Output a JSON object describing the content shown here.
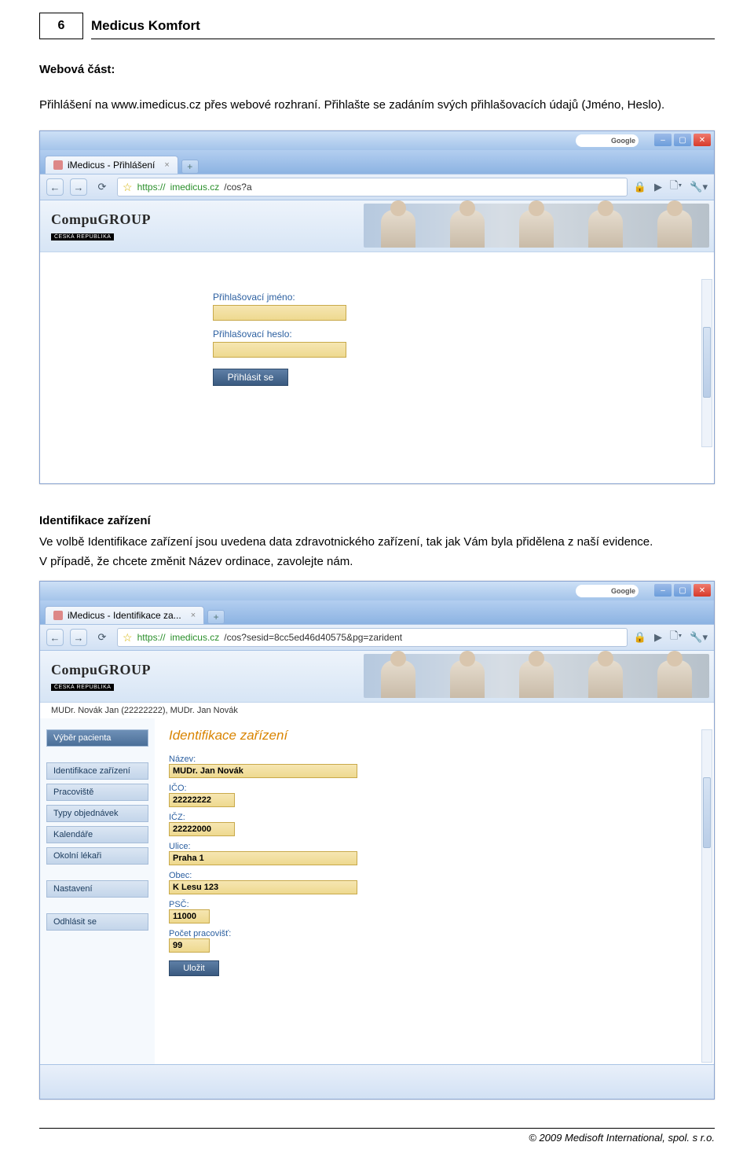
{
  "header": {
    "page_number": "6",
    "title": "Medicus Komfort"
  },
  "section1": {
    "heading": "Webová část:",
    "text_pre": "Přihlášení na www.imedicus.cz přes webové rozhraní. Přihlašte se zadáním svých přihlašovacích údajů (Jméno, Heslo)."
  },
  "browser1": {
    "tab_title": "iMedicus - Přihlášení",
    "newtab": "+",
    "url_scheme": "https://",
    "url_host": "imedicus.cz",
    "url_path": "/cos?a",
    "search_google": "Google",
    "logo_main": "CompuGROUP",
    "logo_sub": "ČESKÁ REPUBLIKA",
    "login": {
      "label_user": "Přihlašovací jméno:",
      "label_pass": "Přihlašovací heslo:",
      "submit": "Přihlásit se"
    }
  },
  "section2": {
    "heading": "Identifikace zařízení",
    "text": "Ve volbě Identifikace zařízení jsou uvedena data zdravotnického zařízení, tak jak Vám byla přidělena z naší evidence.",
    "text2": "V případě, že chcete změnit Název ordinace, zavolejte nám."
  },
  "browser2": {
    "tab_title": "iMedicus - Identifikace za...",
    "newtab": "+",
    "url_scheme": "https://",
    "url_host": "imedicus.cz",
    "url_path": "/cos?sesid=8cc5ed46d40575&pg=zarident",
    "search_google": "Google",
    "logo_main": "CompuGROUP",
    "logo_sub": "ČESKÁ REPUBLIKA",
    "user_info": "MUDr. Novák Jan (22222222), MUDr. Jan Novák",
    "sidebar": [
      "Výběr pacienta",
      "Identifikace zařízení",
      "Pracoviště",
      "Typy objednávek",
      "Kalendáře",
      "Okolní lékaři",
      "Nastavení",
      "Odhlásit se"
    ],
    "panel": {
      "title": "Identifikace zařízení",
      "labels": {
        "nazev": "Název:",
        "ico": "IČO:",
        "icz": "IČZ:",
        "ulice": "Ulice:",
        "obec": "Obec:",
        "psc": "PSČ:",
        "pocet": "Počet pracovišť:"
      },
      "values": {
        "nazev": "MUDr. Jan Novák",
        "ico": "22222222",
        "icz": "22222000",
        "ulice": "Praha 1",
        "obec": "K Lesu 123",
        "psc": "11000",
        "pocet": "99"
      },
      "save": "Uložit"
    }
  },
  "footer": "© 2009 Medisoft International, spol. s r.o."
}
